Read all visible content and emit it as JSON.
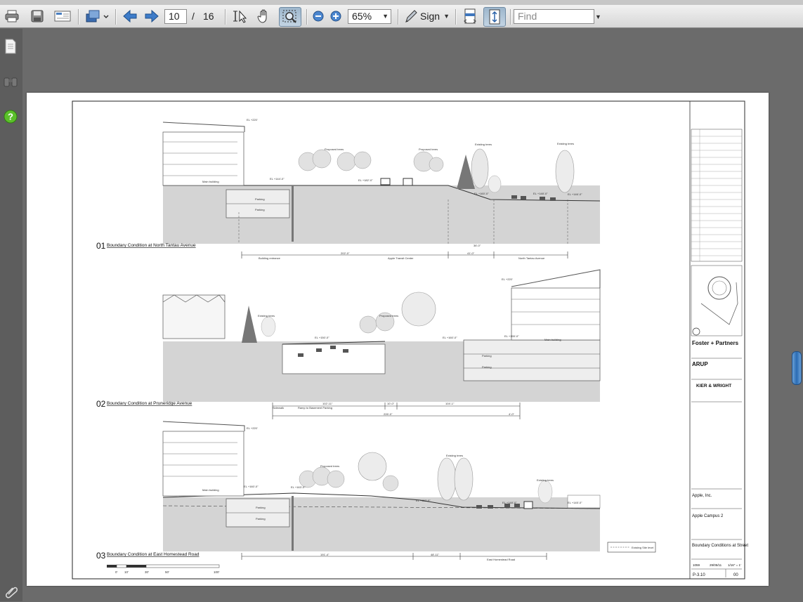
{
  "toolbar": {
    "page_current": "10",
    "page_separator": "/",
    "page_total": "16",
    "zoom": "65%",
    "sign_label": "Sign",
    "find_placeholder": "Find",
    "icons": [
      "print-icon",
      "save-icon",
      "email-icon",
      "share-icon",
      "prev-page-icon",
      "next-page-icon",
      "select-tool-icon",
      "hand-tool-icon",
      "marquee-zoom-icon",
      "zoom-out-icon",
      "zoom-in-icon",
      "sign-pen-icon",
      "fit-width-icon",
      "fit-page-icon"
    ]
  },
  "left_rail": {
    "icons": [
      "pages-icon",
      "binoculars-icon",
      "help-icon"
    ]
  },
  "drawing": {
    "sections": [
      {
        "number": "01",
        "title": "Boundary Condition at North Tantau Avenue",
        "dims": [
          "Building entrance",
          "Apple Transit Center",
          "North Tantau Avenue",
          "202'-0\"",
          "41'-0\"",
          "36'-0\""
        ],
        "labels": [
          "Main building",
          "Parking",
          "Parking",
          "Proposed trees",
          "Proposed trees",
          "Existing trees",
          "Existing trees",
          "EL +220'",
          "EL +182'-0\"",
          "EL +144'-0\"",
          "EL +160'-0\"",
          "EL +148'-0\"",
          "EL +146'-0\""
        ]
      },
      {
        "number": "02",
        "title": "Boundary Condition at Pruneridge Avenue",
        "dims": [
          "Sidewalk",
          "Ramp to Basement Parking",
          "226'-0\"",
          "102'-11\"",
          "10'-0\"",
          "104'-1\"",
          "4'-0\""
        ],
        "labels": [
          "Existing trees",
          "Proposed trees",
          "Main building",
          "Parking",
          "Parking",
          "EL +220'",
          "EL +150'-0\"",
          "EL +155'-0\"",
          "EL +160'-0\""
        ]
      },
      {
        "number": "03",
        "title": "Boundary Condition at East Homestead Road",
        "dims": [
          "East Homestead Road",
          "191'-4\"",
          "48'-11\""
        ],
        "labels": [
          "Main building",
          "Parking",
          "Parking",
          "Proposed trees",
          "Existing trees",
          "Existing trees",
          "EL +220'",
          "EL +160'-0\"",
          "EL +163'-0\"",
          "EL +152'-0\"",
          "EL +148'-0\"",
          "EL +145'-0\""
        ]
      }
    ],
    "legend": "Existing Site level",
    "scale_ticks": [
      "0'",
      "10'",
      "30'",
      "50'",
      "100'"
    ],
    "title_block": {
      "firm1": "Foster + Partners",
      "firm2": "ARUP",
      "firm3": "KIER & WRIGHT",
      "client": "Apple, Inc.",
      "project": "Apple Campus 2",
      "sheet_title": "Boundary Conditions at Street",
      "job": "1059",
      "date": "29/05/11",
      "scale": "1/16\" = 1'",
      "drawing_no": "P-3.10",
      "revision": "00"
    }
  }
}
